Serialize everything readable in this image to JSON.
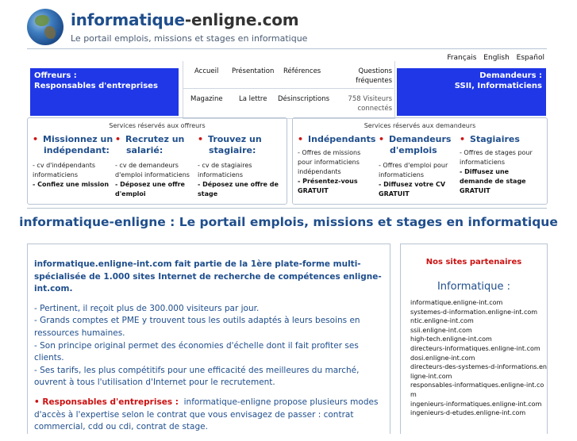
{
  "header": {
    "title_main": "informatique",
    "title_rest": "-enligne.com",
    "tagline": "Le portail emplois, missions et stages en informatique"
  },
  "languages": [
    "Français",
    "English",
    "Español"
  ],
  "offreurs": {
    "line1": "Offreurs :",
    "line2": "Responsables d'entreprises"
  },
  "demandeurs": {
    "line1": "Demandeurs :",
    "line2": "SSII, Informaticiens"
  },
  "nav": {
    "accueil": "Accueil",
    "presentation": "Présentation",
    "references": "Références",
    "questions_1": "Questions",
    "questions_2": "fréquentes",
    "magazine": "Magazine",
    "lettre": "La lettre",
    "desinscriptions": "Désinscriptions",
    "visitors_1": "758 Visiteurs",
    "visitors_2": "connectés"
  },
  "offer_panel": {
    "heading": "Services réservés aux offreurs",
    "col1": {
      "t1": "Missionnez un",
      "t2": "indépendant:",
      "l1": "- cv d'indépendants",
      "l2": "informaticiens",
      "l3": "- Confiez une mission"
    },
    "col2": {
      "t1": "Recrutez un",
      "t2": "salarié:",
      "l1": "- cv de demandeurs",
      "l2": "d'emploi informaticiens",
      "l3": "- Déposez une offre",
      "l4": "d'emploi"
    },
    "col3": {
      "t1": "Trouvez un",
      "t2": "stagiaire:",
      "l1": "- cv de stagiaires",
      "l2": "informaticiens",
      "l3": "- Déposez une offre de",
      "l4": "stage"
    }
  },
  "demand_panel": {
    "heading": "Services réservés aux demandeurs",
    "col1": {
      "t1": "Indépendants",
      "l1": "- Offres de missions",
      "l2": "pour informaticiens",
      "l3": "indépendants",
      "l4": "- Présentez-vous",
      "l5": "GRATUIT"
    },
    "col2": {
      "t1": "Demandeurs",
      "t2": "d'emplois",
      "l1": "- Offres d'emploi pour",
      "l2": "informaticiens",
      "l3": "- Diffusez votre CV",
      "l4": "GRATUIT"
    },
    "col3": {
      "t1": "Stagiaires",
      "l1": "- Offres de stages pour",
      "l2": "informaticiens",
      "l3": "- Diffusez une",
      "l4": "demande de stage",
      "l5": "GRATUIT"
    }
  },
  "main_title": "informatique-enligne : Le portail emplois, missions et stages en informatique",
  "main": {
    "intro": "informatique.enligne-int.com fait partie de la 1ère plate-forme multi-spécialisée de 1.000 sites Internet de recherche de compétences enligne-int.com.",
    "p1": "- Pertinent, il reçoit plus de 300.000 visiteurs par jour.",
    "p2": "- Grands comptes et PME y trouvent tous les outils adaptés à leurs besoins en ressources humaines.",
    "p3": "- Son principe original permet des économies d'échelle dont il fait profiter ses clients.",
    "p4": "- Ses tarifs, les plus compétitifs pour une efficacité des meilleures du marché, ouvrent à tous l'utilisation d'Internet pour le recrutement.",
    "resp_label": "Responsables d'entreprises :",
    "resp_text": "informatique-enligne propose plusieurs modes d'accès à l'expertise selon le contrat que vous envisagez de passer : contrat commercial, cdd ou cdi, contrat de stage."
  },
  "partners": {
    "title": "Nos sites partenaires",
    "subtitle": "Informatique :",
    "sites": [
      "informatique.enligne-int.com",
      "systemes-d-information.enligne-int.com",
      "ntic.enligne-int.com",
      "ssii.enligne-int.com",
      "high-tech.enligne-int.com",
      "directeurs-informatiques.enligne-int.com",
      "dosi.enligne-int.com",
      "directeurs-des-systemes-d-informations.enligne-int.com",
      "responsables-informatiques.enligne-int.com",
      "ingenieurs-informatiques.enligne-int.com",
      "ingenieurs-d-etudes.enligne-int.com"
    ]
  }
}
